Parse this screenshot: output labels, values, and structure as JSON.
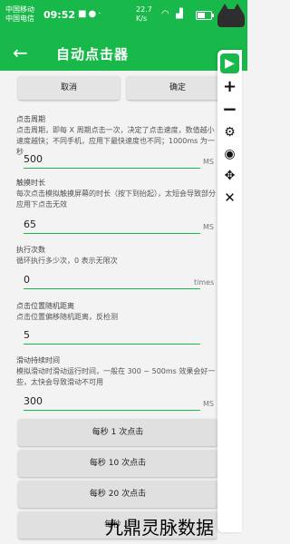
{
  "status_bar": {
    "carrier_line1": "中国移动",
    "carrier_line2": "中国电信",
    "time": "09:52",
    "net_speed": "22.7",
    "net_unit": "K/s",
    "battery_level": 0.6
  },
  "app_bar": {
    "back_icon": "arrow-left",
    "title": "自动点击器"
  },
  "dialog": {
    "cancel_label": "取消",
    "confirm_label": "确定"
  },
  "fields": {
    "click_period": {
      "label": "点击周期",
      "description": "点击周期，即每 X 周期点击一次，决定了点击速度，数值越小速度越快；不同手机，应用下最快速度也不同；1000ms 为一秒",
      "value": "500",
      "unit": "MS"
    },
    "touch_duration": {
      "label": "触摸时长",
      "description": "每次点击模拟触摸屏幕的时长（按下到抬起），太短会导致部分应用下点击无效",
      "value": "65",
      "unit": "MS"
    },
    "repeat_count": {
      "label": "执行次数",
      "description": "循环执行多少次，0 表示无限次",
      "value": "0",
      "unit": "times"
    },
    "random_offset": {
      "label": "点击位置随机距离",
      "description": "点击位置偏移随机距离，反检测",
      "value": "5",
      "unit": ""
    },
    "swipe_duration": {
      "label": "滑动持续时间",
      "description": "模拟滑动时滑动运行时间，一般在 300 ~ 500ms 效果会好一些，太快会导致滑动不可用",
      "value": "300",
      "unit": "MS"
    }
  },
  "presets": [
    {
      "label": "每秒 1 次点击"
    },
    {
      "label": "每秒 10 次点击"
    },
    {
      "label": "每秒 20 次点击"
    },
    {
      "label": "每秒 ..."
    }
  ],
  "float_bar": {
    "icons": [
      "play-icon",
      "plus-icon",
      "minus-icon",
      "gear-icon",
      "eye-icon",
      "move-icon",
      "close-icon"
    ]
  },
  "watermark": "九鼎灵脉数据"
}
